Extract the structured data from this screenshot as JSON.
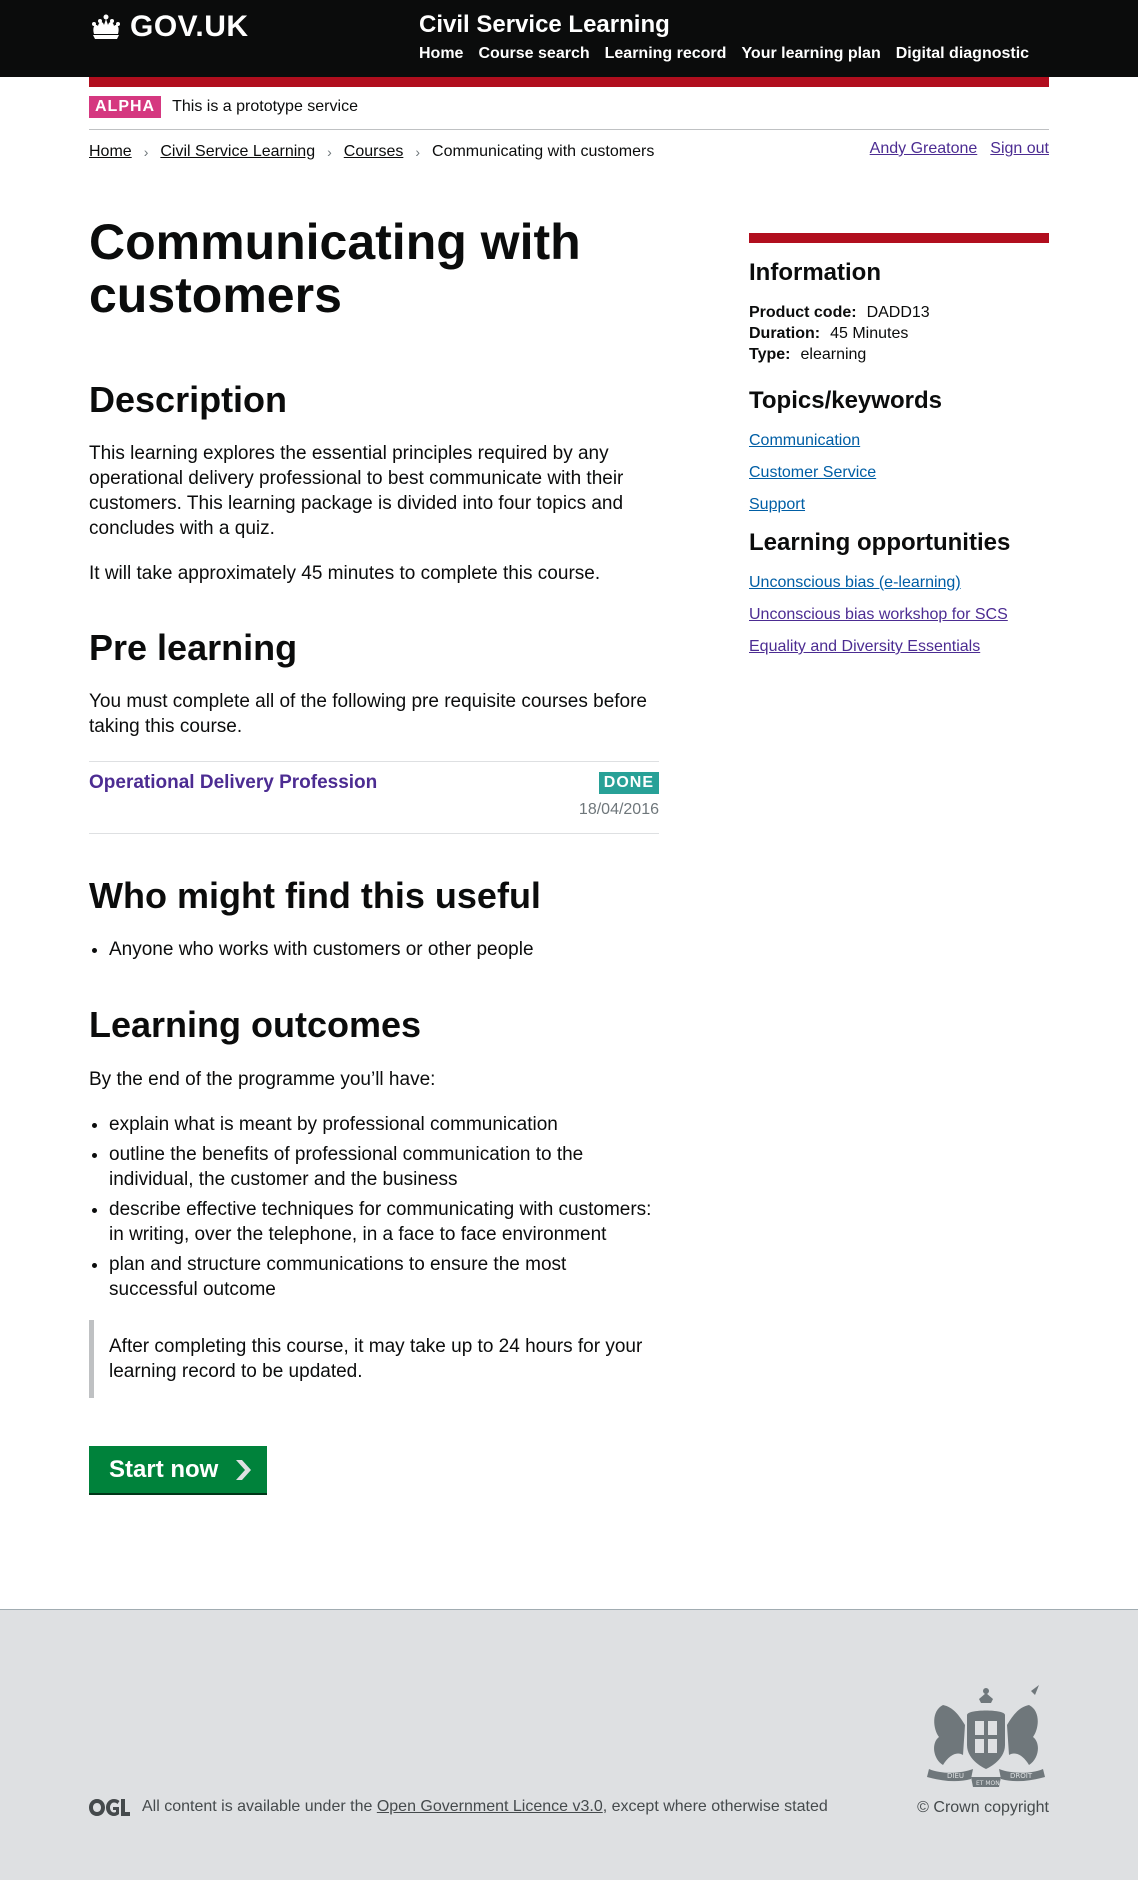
{
  "header": {
    "logo_text": "GOV.UK",
    "service_name": "Civil Service Learning",
    "nav": [
      "Home",
      "Course search",
      "Learning record",
      "Your learning plan",
      "Digital diagnostic"
    ],
    "accent_color": "#b10e1e"
  },
  "phase_banner": {
    "tag": "ALPHA",
    "text": "This is a prototype service",
    "tag_color": "#d53880"
  },
  "breadcrumbs": [
    "Home",
    "Civil Service Learning",
    "Courses",
    "Communicating with customers"
  ],
  "account": {
    "user_name": "Andy Greatone",
    "sign_out": "Sign out"
  },
  "course": {
    "title": "Communicating with customers",
    "description_heading": "Description",
    "description": "This learning explores the essential principles required by any operational delivery professional to best communicate with their customers. This learning package is divided into four topics and concludes with a quiz.",
    "duration_text": "It will take approximately 45 minutes to complete this course.",
    "pre_learning_heading": "Pre learning",
    "pre_learning_text": "You must complete all of the following pre requisite courses before taking this course.",
    "prerequisite": {
      "title": "Operational Delivery Profession",
      "status": "DONE",
      "date": "18/04/2016",
      "status_color": "#28a197"
    },
    "who_heading": "Who might find this useful",
    "who_items": [
      "Anyone who works with customers or other people"
    ],
    "outcomes_heading": "Learning outcomes",
    "outcomes_intro": "By the end of the programme you’ll have:",
    "outcomes": [
      "explain what is meant by professional communication",
      "outline the benefits of professional communication to the individual, the customer and the business",
      "describe effective techniques for communicating with customers: in writing, over the telephone, in a face to face environment",
      "plan and structure communications to ensure the most successful outcome"
    ],
    "inset_text": "After completing this course, it may take up to 24 hours for your learning record to be updated.",
    "start_button": "Start now",
    "start_button_color": "#00823b"
  },
  "sidebar": {
    "info_heading": "Information",
    "info": [
      {
        "label": "Product code:",
        "value": "DADD13"
      },
      {
        "label": "Duration:",
        "value": "45 Minutes"
      },
      {
        "label": "Type:",
        "value": "elearning"
      }
    ],
    "topics_heading": "Topics/keywords",
    "topics": [
      "Communication",
      "Customer Service",
      "Support"
    ],
    "opportunities_heading": "Learning opportunities",
    "opportunities": [
      "Unconscious bias (e-learning)",
      "Unconscious bias workshop for SCS",
      "Equality and Diversity Essentials"
    ]
  },
  "footer": {
    "licence_prefix": "All content is available under the",
    "licence_link": "Open Government Licence v3.0",
    "licence_suffix": ", except where otherwise stated",
    "copyright": "© Crown copyright",
    "crest_text_left": "DIEU",
    "crest_text_right": "DROIT",
    "crest_text_center": "ET MON"
  }
}
